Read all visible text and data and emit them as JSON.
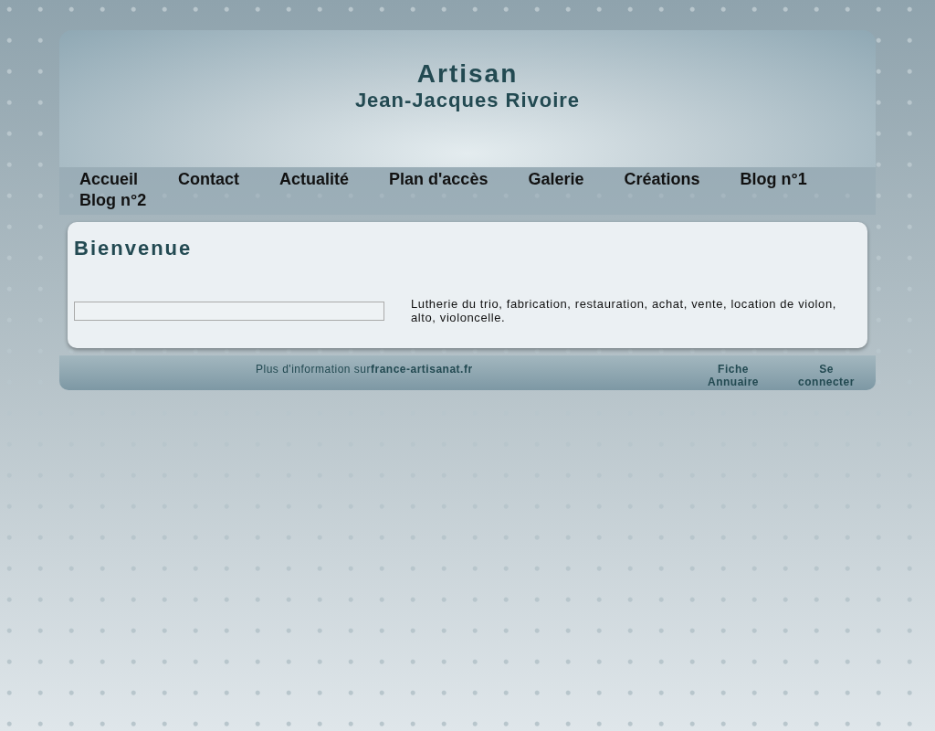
{
  "header": {
    "title": "Artisan",
    "subtitle": "Jean-Jacques Rivoire"
  },
  "nav": {
    "items": [
      {
        "label": "Accueil"
      },
      {
        "label": "Contact"
      },
      {
        "label": "Actualité"
      },
      {
        "label": "Plan d'accès"
      },
      {
        "label": "Galerie"
      },
      {
        "label": "Créations"
      },
      {
        "label": "Blog n°1"
      },
      {
        "label": "Blog n°2"
      }
    ]
  },
  "content": {
    "heading": "Bienvenue",
    "description": "Lutherie du trio, fabrication, restauration, achat, vente, location de violon, alto, violoncelle."
  },
  "footer": {
    "info_text": "Plus d'information sur",
    "info_link": "france-artisanat.fr",
    "links": [
      {
        "label": "Fiche Annuaire"
      },
      {
        "label": "Se connecter"
      }
    ]
  }
}
